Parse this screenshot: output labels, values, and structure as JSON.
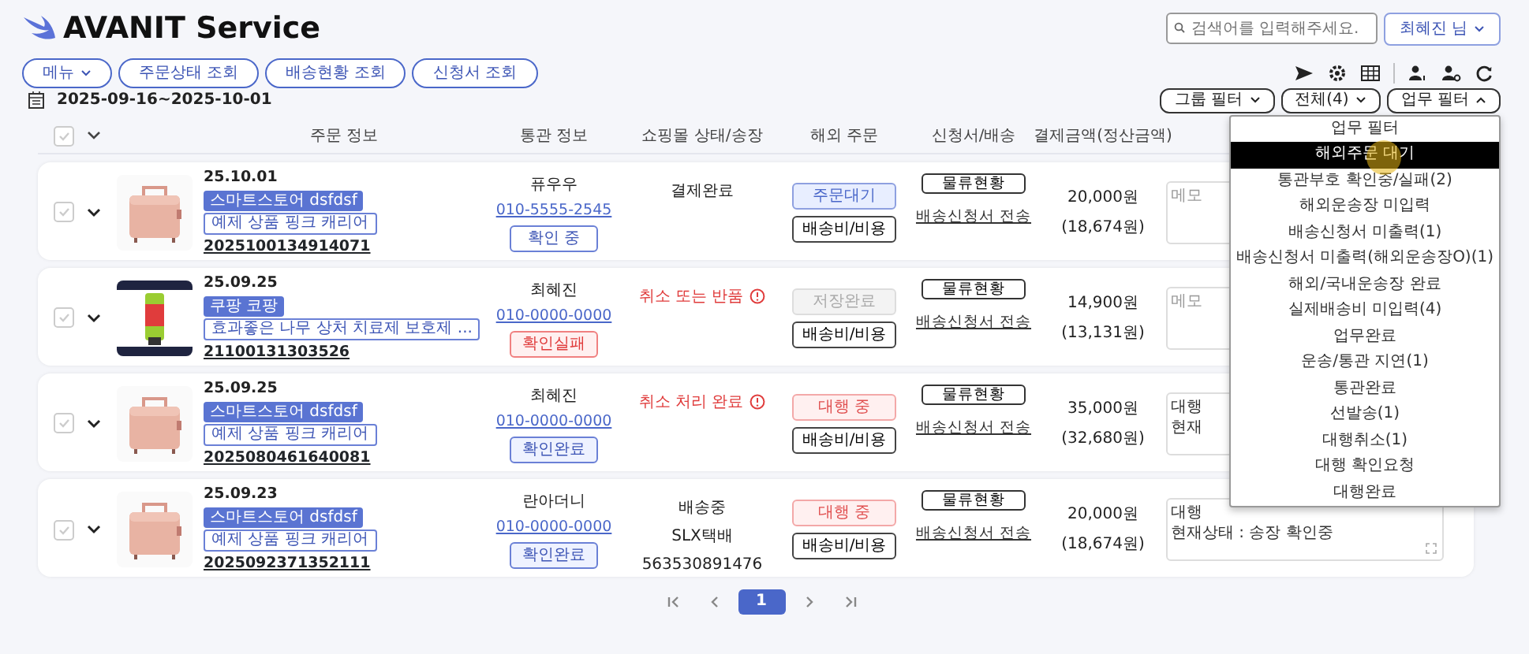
{
  "app": {
    "title": "AVANIT Service"
  },
  "search": {
    "placeholder": "검색어를 입력해주세요."
  },
  "user_button": {
    "label": "최혜진 님"
  },
  "nav_buttons": [
    {
      "label": "메뉴",
      "dropdown": true
    },
    {
      "label": "주문상태 조회",
      "dropdown": false
    },
    {
      "label": "배송현황 조회",
      "dropdown": false
    },
    {
      "label": "신청서 조회",
      "dropdown": false
    }
  ],
  "date_range": "2025-09-16~2025-10-01",
  "filters": [
    {
      "label": "그룹 필터",
      "open": false
    },
    {
      "label": "전체(4)",
      "open": false
    },
    {
      "label": "업무 필터",
      "open": true
    }
  ],
  "filter_menu": {
    "title": "업무 필터",
    "items": [
      {
        "label": "해외주문 대기",
        "selected": true
      },
      {
        "label": "통관부호 확인중/실패(2)",
        "selected": false
      },
      {
        "label": "해외운송장 미입력",
        "selected": false
      },
      {
        "label": "배송신청서 미출력(1)",
        "selected": false
      },
      {
        "label": "배송신청서 미출력(해외운송장O)(1)",
        "selected": false
      },
      {
        "label": "해외/국내운송장 완료",
        "selected": false
      },
      {
        "label": "실제배송비 미입력(4)",
        "selected": false
      },
      {
        "label": "업무완료",
        "selected": false
      },
      {
        "label": "운송/통관 지연(1)",
        "selected": false
      },
      {
        "label": "통관완료",
        "selected": false
      },
      {
        "label": "선발송(1)",
        "selected": false
      },
      {
        "label": "대행취소(1)",
        "selected": false
      },
      {
        "label": "대행 확인요청",
        "selected": false
      },
      {
        "label": "대행완료",
        "selected": false
      }
    ]
  },
  "table": {
    "select_all": {
      "checked": false
    },
    "columns": [
      "주문 정보",
      "통관 정보",
      "쇼핑몰 상태/송장",
      "해외 주문",
      "신청서/배송",
      "결제금액(정산금액)"
    ]
  },
  "orders": [
    {
      "checked": false,
      "date": "25.10.01",
      "store": "스마트스토어 dsfdsf",
      "product": "예제 상품 핑크 캐리어",
      "order_no": "2025100134914071",
      "customer": "퓨우우",
      "phone": "010-5555-2545",
      "customs_status": {
        "label": "확인 중",
        "kind": "pending"
      },
      "shop_status": {
        "kind": "plain",
        "lines": [
          "결제완료"
        ]
      },
      "overseas_status": {
        "label": "주문대기",
        "kind": "waiting"
      },
      "shipping_fee_button": "배송비/비용",
      "logistics_button": "물류현황",
      "application_link": "배송신청서 전송",
      "amount": "20,000원",
      "settlement": "(18,674원)",
      "memo": {
        "placeholder": "메모"
      }
    },
    {
      "checked": false,
      "date": "25.09.25",
      "store": "쿠팡 코팡",
      "product": "효과좋은 나무 상처 치료제 보호제 ...",
      "order_no": "21100131303526",
      "customer": "최혜진",
      "phone": "010-0000-0000",
      "customs_status": {
        "label": "확인실패",
        "kind": "failed"
      },
      "shop_status": {
        "kind": "alert",
        "lines": [
          "취소 또는 반품"
        ]
      },
      "overseas_status": {
        "label": "저장완료",
        "kind": "saved"
      },
      "shipping_fee_button": "배송비/비용",
      "logistics_button": "물류현황",
      "application_link": "배송신청서 전송",
      "amount": "14,900원",
      "settlement": "(13,131원)",
      "memo": {
        "placeholder": "메모"
      }
    },
    {
      "checked": false,
      "date": "25.09.25",
      "store": "스마트스토어 dsfdsf",
      "product": "예제 상품 핑크 캐리어",
      "order_no": "2025080461640081",
      "customer": "최혜진",
      "phone": "010-0000-0000",
      "customs_status": {
        "label": "확인완료",
        "kind": "done"
      },
      "shop_status": {
        "kind": "alert",
        "lines": [
          "취소 처리 완료"
        ]
      },
      "overseas_status": {
        "label": "대행 중",
        "kind": "agency"
      },
      "shipping_fee_button": "배송비/비용",
      "logistics_button": "물류현황",
      "application_link": "배송신청서 전송",
      "amount": "35,000원",
      "settlement": "(32,680원)",
      "memo": {
        "lines": [
          "대행",
          "현재"
        ]
      }
    },
    {
      "checked": false,
      "date": "25.09.23",
      "store": "스마트스토어 dsfdsf",
      "product": "예제 상품 핑크 캐리어",
      "order_no": "2025092371352111",
      "customer": "란아더니",
      "phone": "010-0000-0000",
      "customs_status": {
        "label": "확인완료",
        "kind": "done"
      },
      "shop_status": {
        "kind": "plain",
        "lines": [
          "배송중",
          "SLX택배",
          "563530891476"
        ]
      },
      "overseas_status": {
        "label": "대행 중",
        "kind": "agency"
      },
      "shipping_fee_button": "배송비/비용",
      "logistics_button": "물류현황",
      "application_link": "배송신청서 전송",
      "amount": "20,000원",
      "settlement": "(18,674원)",
      "memo": {
        "lines": [
          "대행",
          "현재상태 : 송장 확인중"
        ]
      }
    }
  ],
  "pagination": {
    "pages": [
      {
        "label": "1",
        "selected": true
      }
    ]
  }
}
